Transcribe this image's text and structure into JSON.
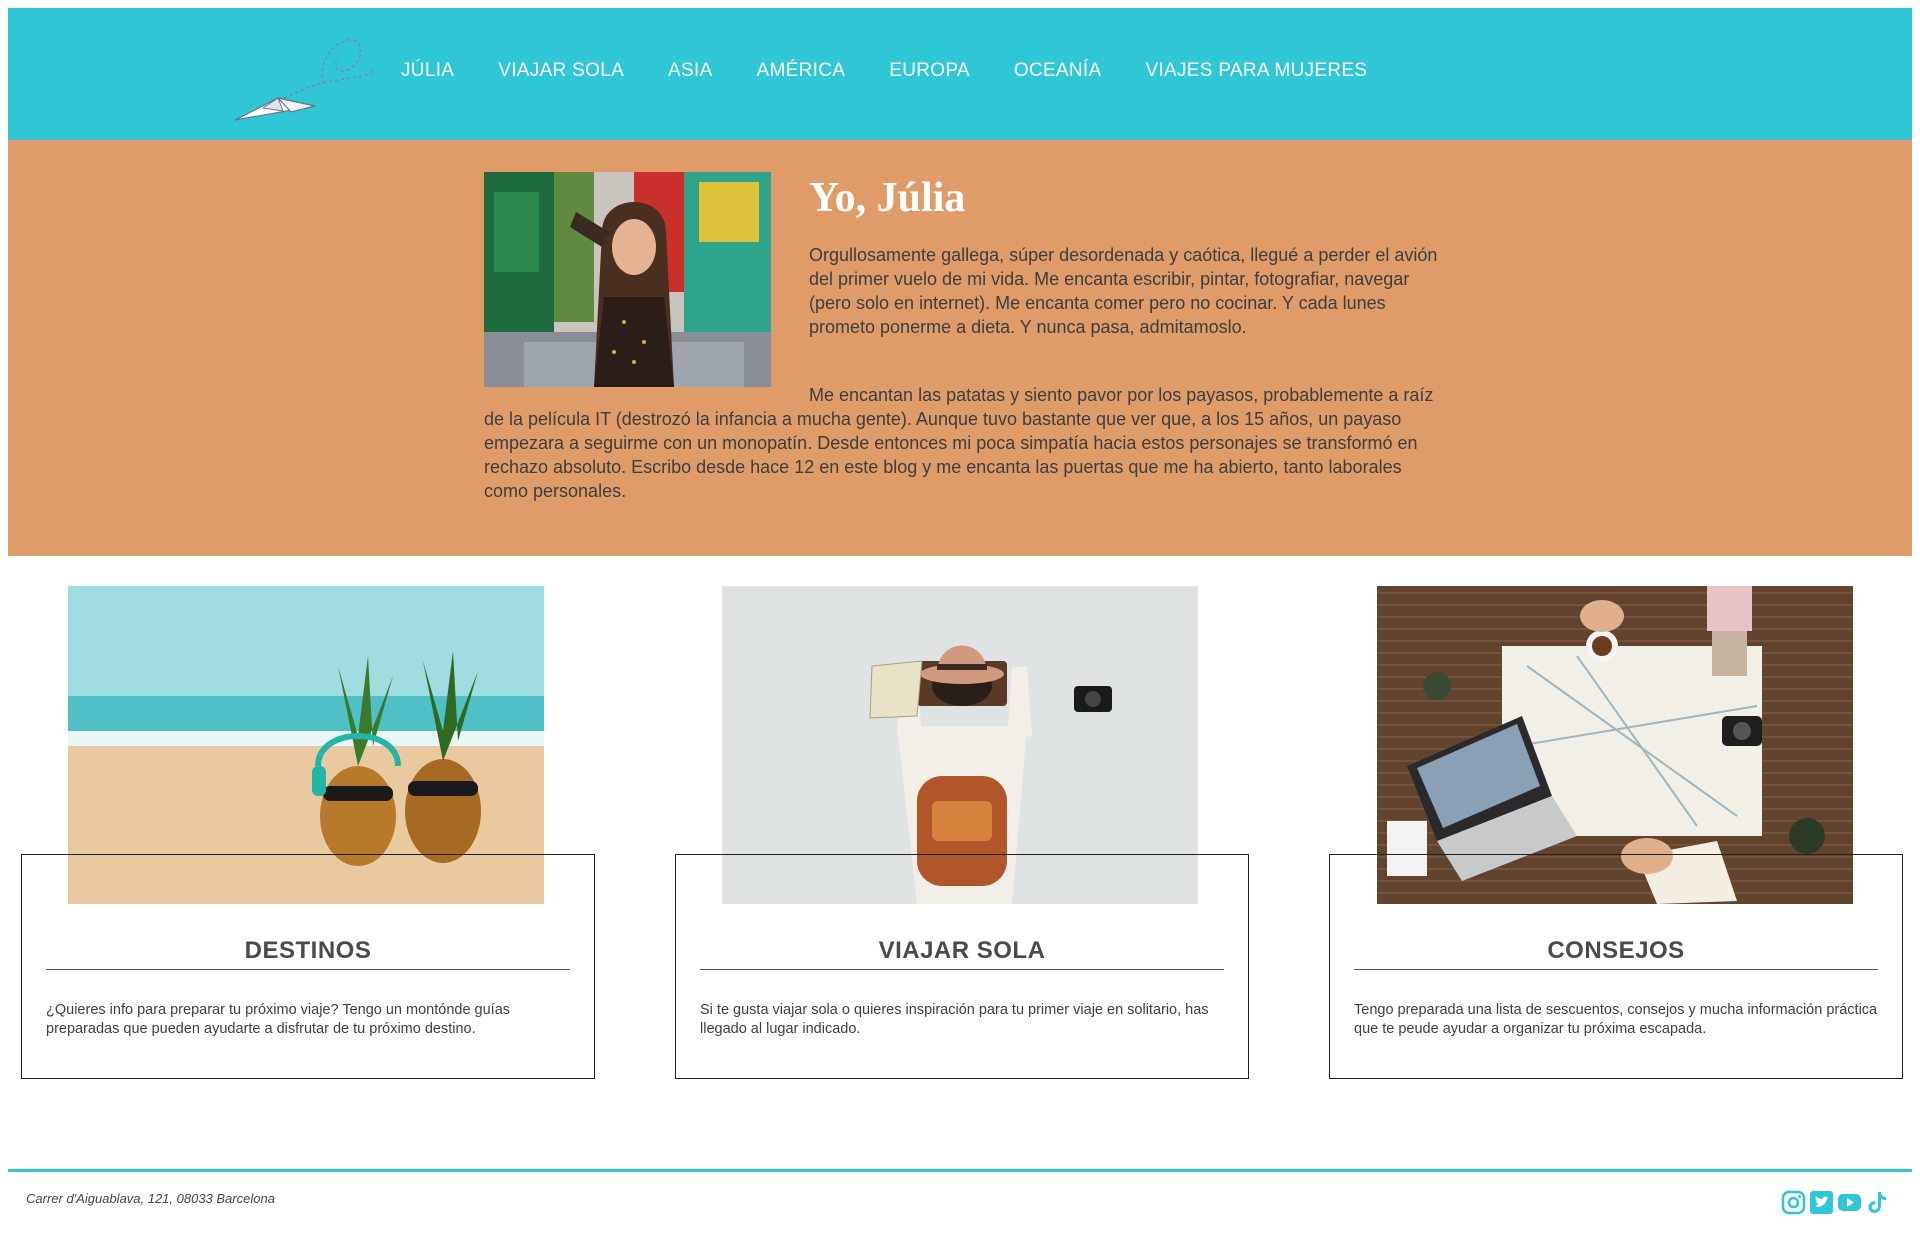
{
  "nav": {
    "items": [
      "JÚLIA",
      "VIAJAR SOLA",
      "ASIA",
      "AMÉRICA",
      "EUROPA",
      "OCEANÍA",
      "VIAJES PARA MUJERES"
    ]
  },
  "about": {
    "title": "Yo, Júlia",
    "paragraph1": "Orgullosamente gallega, súper desordenada y caótica, llegué a perder el avión del primer vuelo de mi vida. Me encanta escribir, pintar, fotografiar, navegar (pero solo en internet). Me encanta comer pero no cocinar. Y cada lunes prometo ponerme a dieta. Y nunca pasa, admitamoslo.",
    "paragraph2": "Me encantan las patatas y siento pavor por los payasos, probablemente a raíz de la película IT (destrozó la infancia a mucha gente). Aunque tuvo bastante que ver que, a los 15 años, un payaso empezara a seguirme con un monopatín. Desde entonces mi poca simpatía hacia estos personajes se transformó en rechazo absoluto. Escribo desde hace 12 en este blog y me encanta las puertas que me ha abierto, tanto laborales como personales."
  },
  "cards": [
    {
      "title": "DESTINOS",
      "text": "¿Quieres info para preparar tu próximo viaje? Tengo un montónde guías preparadas que pueden ayudarte a disfrutar de tu próximo destino."
    },
    {
      "title": "VIAJAR SOLA",
      "text": "Si te gusta viajar sola o quieres inspiración para tu primer viaje en solitario, has llegado al lugar indicado."
    },
    {
      "title": "CONSEJOS",
      "text": "Tengo preparada una lista de sescuentos, consejos y mucha información práctica que te peude ayudar a organizar tu próxima escapada."
    }
  ],
  "footer": {
    "address": "Carrer d'Aiguablava, 121, 08033 Barcelona",
    "socials": [
      "instagram-icon",
      "twitter-icon",
      "youtube-icon",
      "tiktok-icon"
    ]
  },
  "colors": {
    "header": "#2fc6d6",
    "about_bg": "#df9c69",
    "footer_line": "#2fc6d6"
  }
}
